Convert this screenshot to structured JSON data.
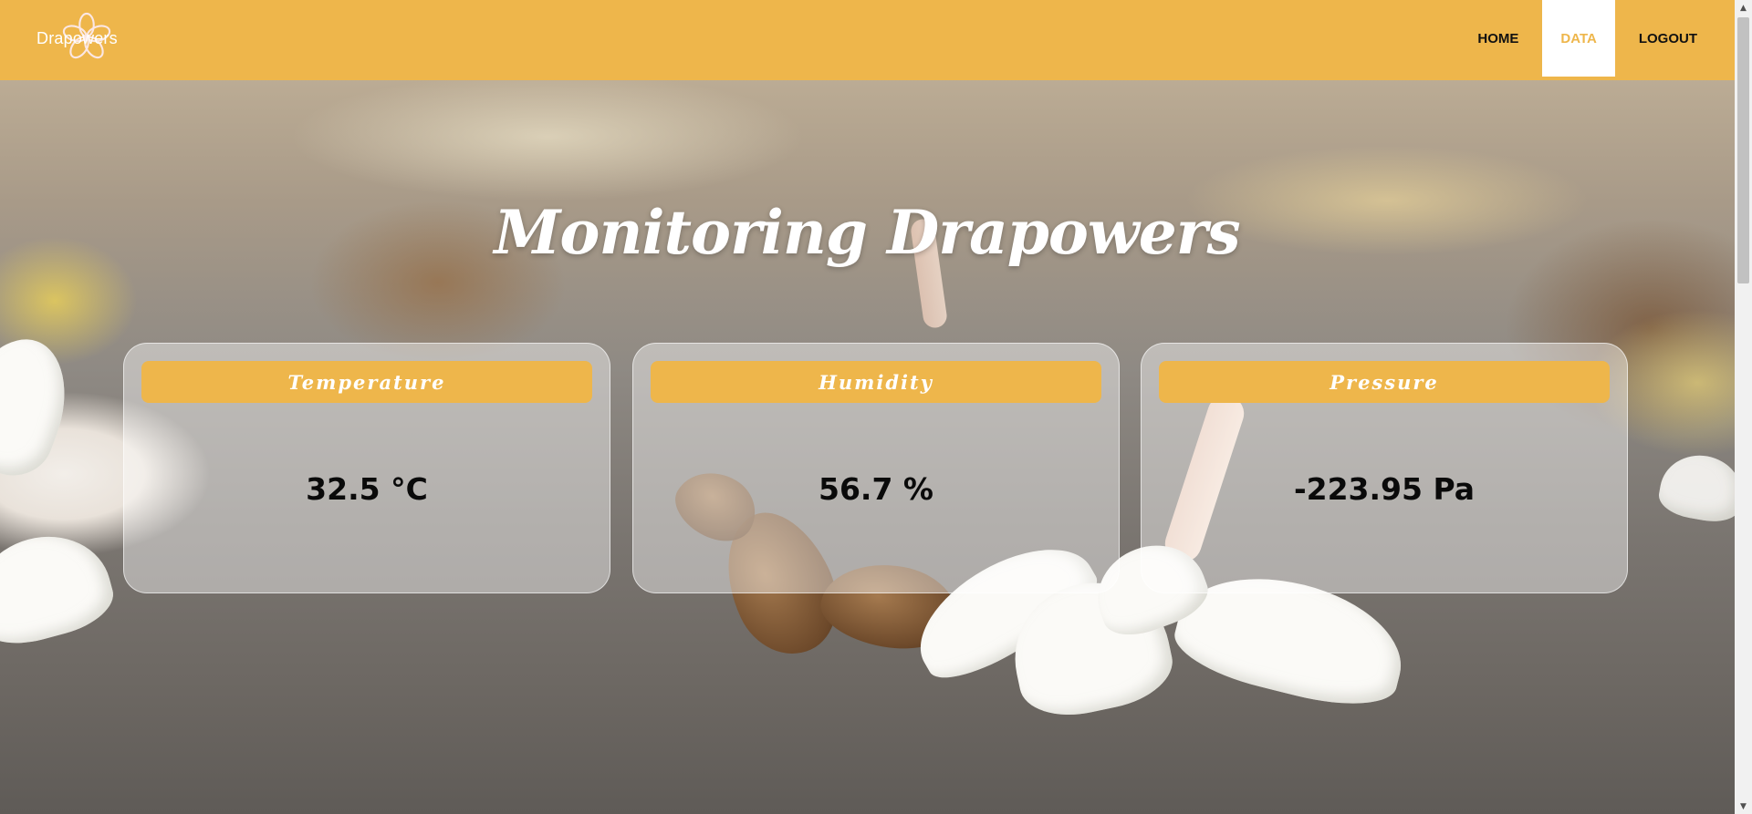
{
  "brand": {
    "name": "Drapowers",
    "logo_icon": "plumeria-flower-icon"
  },
  "nav": {
    "items": [
      {
        "label": "HOME",
        "active": false
      },
      {
        "label": "DATA",
        "active": true
      },
      {
        "label": "LOGOUT",
        "active": false
      }
    ]
  },
  "page": {
    "title": "Monitoring Drapowers"
  },
  "cards": [
    {
      "label": "Temperature",
      "value": "32.5 °C"
    },
    {
      "label": "Humidity",
      "value": "56.7 %"
    },
    {
      "label": "Pressure",
      "value": "-223.95 Pa"
    }
  ],
  "colors": {
    "accent": "#eeb64b",
    "nav_text": "#111111",
    "active_text": "#eeb64b",
    "card_bg": "rgba(255,255,255,0.42)"
  }
}
